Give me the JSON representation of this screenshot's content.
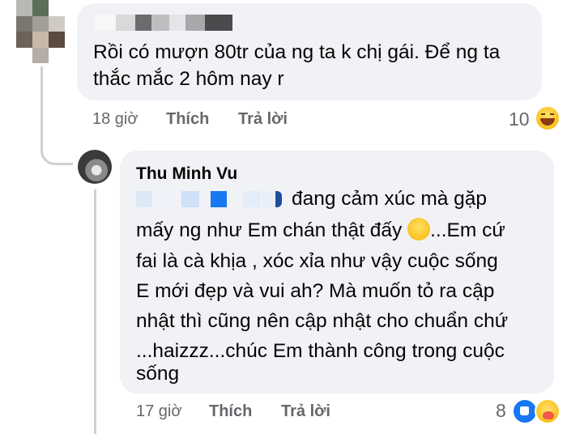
{
  "comment1": {
    "text_line1": "Rồi có mượn 80tr của ng ta k chị gái. Để ng ta",
    "text_line2": "thắc mắc 2 hôm nay r",
    "time": "18 giờ",
    "like_label": "Thích",
    "reply_label": "Trả lời",
    "reaction_count": "10",
    "reaction_icon": "haha-emoji-icon"
  },
  "comment2": {
    "author": "Thu Minh Vu",
    "line1_after_mention": "đang cảm xúc mà gặp",
    "line2": "mấy ng như Em chán thật đấy",
    "line2_after_emoji": "...Em cứ",
    "line3": "fai là cà khịa , xóc xỉa như vậy cuộc sống",
    "line4": "E mới đẹp và vui ah? Mà muốn tỏ ra cập",
    "line5": "nhật thì cũng nên cập nhật cho chuẩn chứ",
    "line6": "...haizzz...chúc Em thành công trong cuộc",
    "line7": "sống",
    "time": "17 giờ",
    "like_label": "Thích",
    "reply_label": "Trả lời",
    "reaction_count": "8",
    "reaction_icons": [
      "like-icon",
      "care-icon"
    ]
  },
  "colors": {
    "bubble": "#f0f2f5",
    "meta_text": "#65676b",
    "like_blue": "#1877f2",
    "haha_yellow": "#f7b500"
  }
}
